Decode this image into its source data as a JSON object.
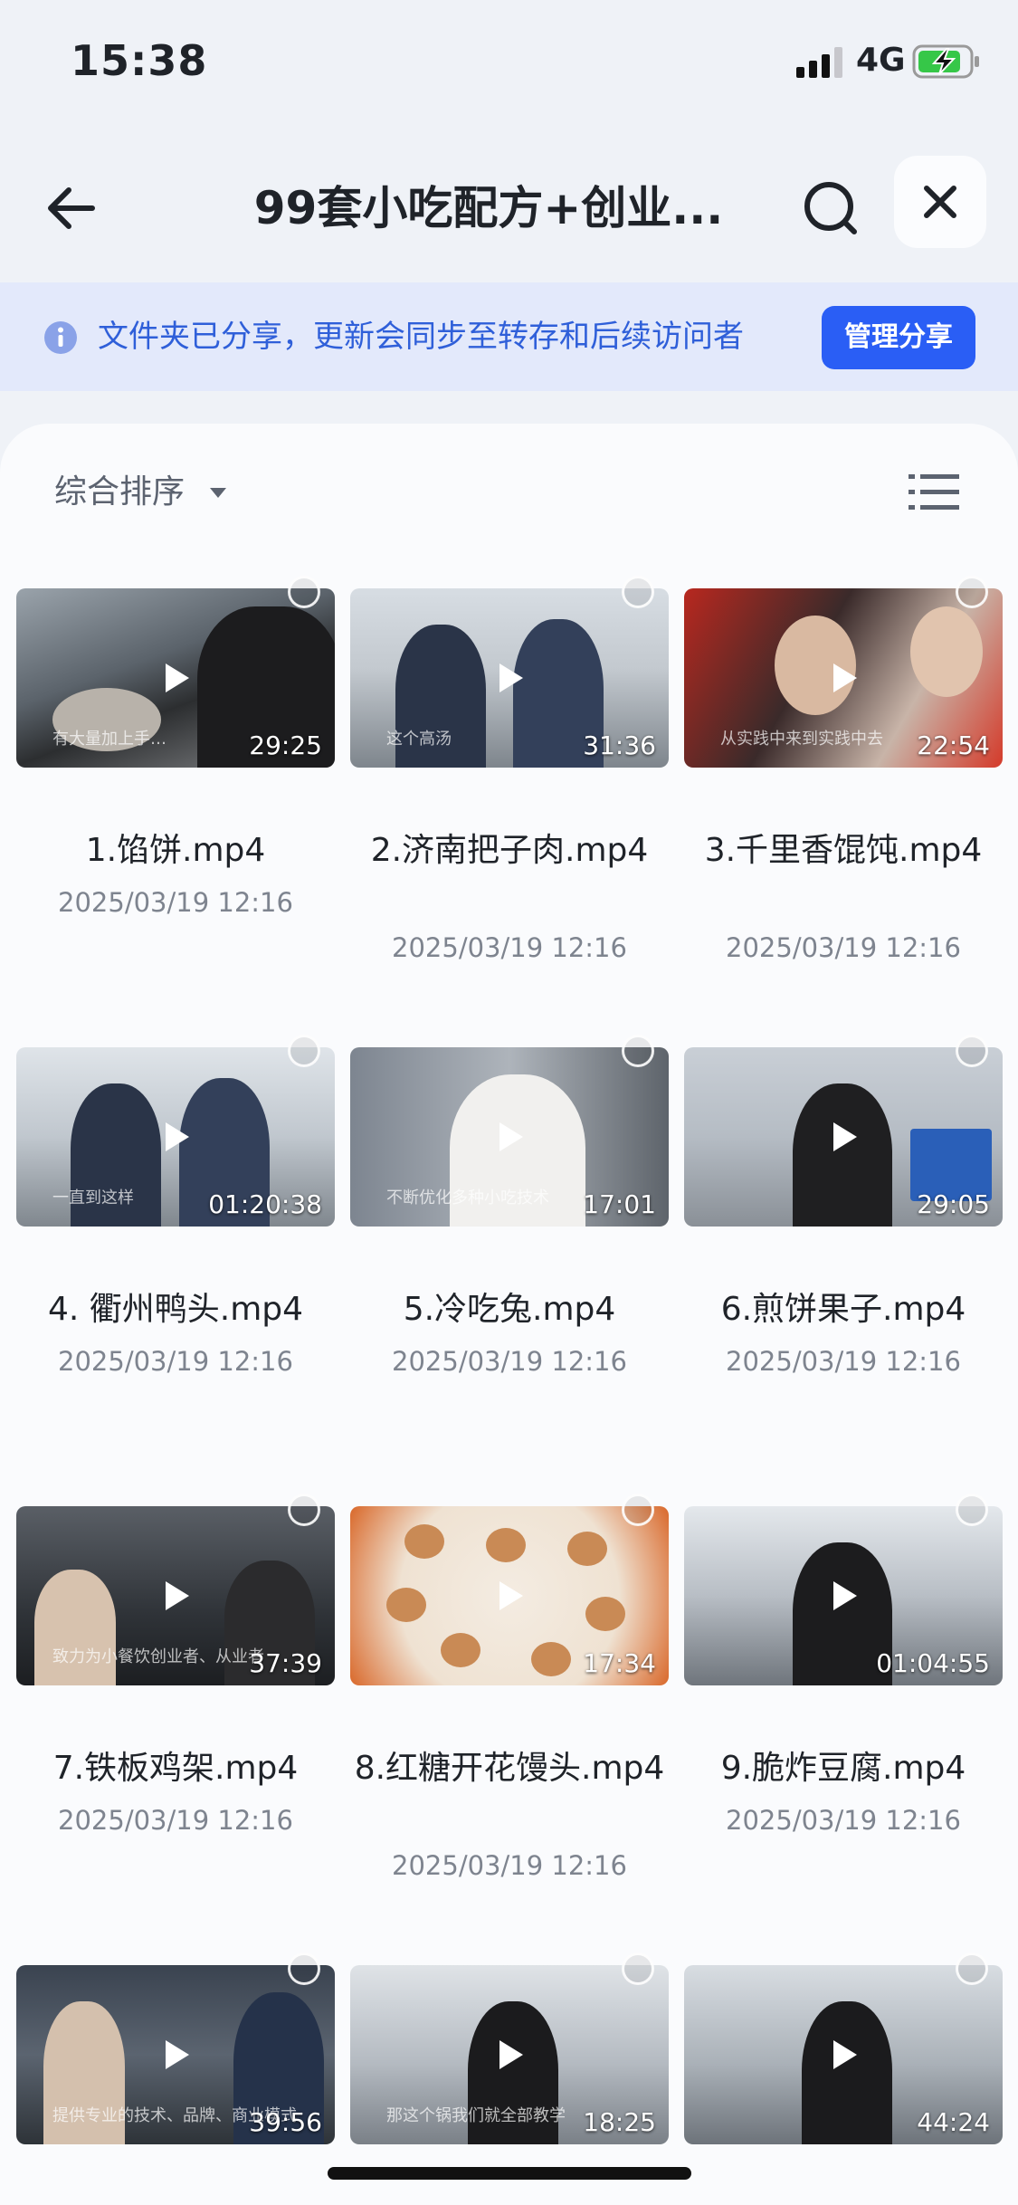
{
  "status_bar": {
    "time": "15:38",
    "network": "4G"
  },
  "header": {
    "title": "99套小吃配方+创业..."
  },
  "notice": {
    "text": "文件夹已分享，更新会同步至转存和后续访问者",
    "button": "管理分享"
  },
  "toolbar": {
    "sort_label": "综合排序"
  },
  "files": [
    {
      "name": "1.馅饼.mp4",
      "date": "2025/03/19 12:16",
      "duration": "29:25",
      "caption": "有大量加上手…"
    },
    {
      "name": "2.济南把子肉.mp4",
      "date": "2025/03/19 12:16",
      "duration": "31:36",
      "caption": "这个高汤"
    },
    {
      "name": "3.千里香馄饨.mp4",
      "date": "2025/03/19 12:16",
      "duration": "22:54",
      "caption": "从实践中来到实践中去"
    },
    {
      "name": "4. 衢州鸭头.mp4",
      "date": "2025/03/19 12:16",
      "duration": "01:20:38",
      "caption": "一直到这样"
    },
    {
      "name": "5.冷吃兔.mp4",
      "date": "2025/03/19 12:16",
      "duration": "17:01",
      "caption": "不断优化多种小吃技术"
    },
    {
      "name": "6.煎饼果子.mp4",
      "date": "2025/03/19 12:16",
      "duration": "29:05",
      "caption": ""
    },
    {
      "name": "7.铁板鸡架.mp4",
      "date": "2025/03/19 12:16",
      "duration": "37:39",
      "caption": "致力为小餐饮创业者、从业者"
    },
    {
      "name": "8.红糖开花馒头.mp4",
      "date": "2025/03/19 12:16",
      "duration": "17:34",
      "caption": ""
    },
    {
      "name": "9.脆炸豆腐.mp4",
      "date": "2025/03/19 12:16",
      "duration": "01:04:55",
      "caption": ""
    },
    {
      "name": "",
      "date": "",
      "duration": "39:56",
      "caption": "提供专业的技术、品牌、商业模式"
    },
    {
      "name": "",
      "date": "",
      "duration": "18:25",
      "caption": "那这个锅我们就全部教学"
    },
    {
      "name": "",
      "date": "",
      "duration": "44:24",
      "caption": ""
    }
  ],
  "colors": {
    "accent": "#2a5ef5",
    "notice_bg": "#e3e9fb",
    "notice_text": "#2f5fd9",
    "page_bg": "#eff2f7"
  }
}
